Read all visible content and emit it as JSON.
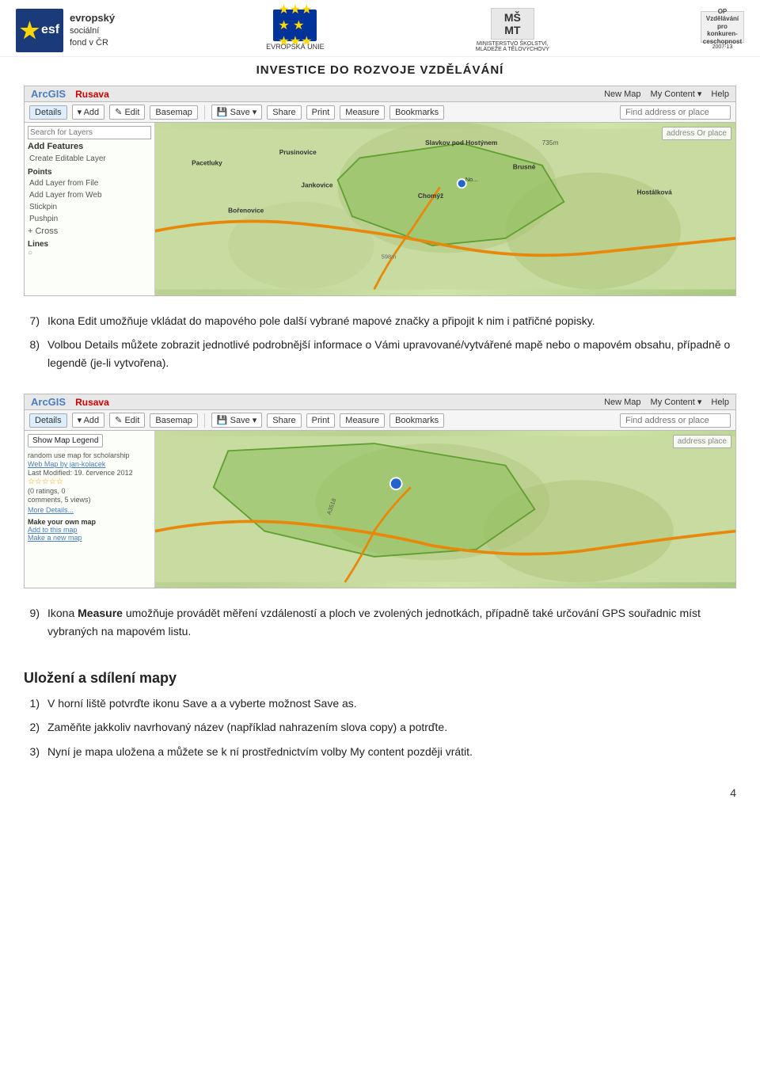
{
  "header": {
    "logo_esf_text": "esf",
    "logo_esf_subtitle1": "evropský",
    "logo_esf_subtitle2": "sociální",
    "logo_esf_subtitle3": "fond v ČR",
    "logo_eu_text": "EVROPSKÁ UNIE",
    "logo_msmt_subtitle": "MINISTERSTVO ŠKOLSTVÍ,\nMÁDEŽE A TĚLOVÝCHOVY",
    "logo_op_text": "OP Vzdělávání\npro\nkonkurenceschopnost",
    "investice_title": "INVESTICE DO ROZVOJE VZDĚLÁVÁNÍ"
  },
  "arcgis_bar1": {
    "brand": "ArcGIS",
    "map_name": "Rusava",
    "nav_items": [
      "New Map",
      "My Content ▾",
      "Help"
    ]
  },
  "arcgis_toolbar1": {
    "details_btn": "Details",
    "add_btn": "▾ Add",
    "edit_btn": "✎ Edit",
    "basemap_btn": "Basemap",
    "save_btn": "💾 Save ▾",
    "share_btn": "Share",
    "print_btn": "Print",
    "measure_btn": "Measure",
    "bookmarks_btn": "Bookmarks",
    "find_placeholder": "Find address or place"
  },
  "map1": {
    "left_panel": {
      "search_placeholder": "Search for Layers",
      "add_features_title": "Add Features",
      "points_label": "Points",
      "add_layer_title": "Add Layer from File",
      "add_layer_web": "Add Layer from Web",
      "stickpin_label": "Stickpin",
      "pushpin_label": "Pushpin",
      "cross_label": "Cross",
      "lines_label": "Lines",
      "create_layer": "Create Editable Layer"
    },
    "place_names": [
      "Pacetluky",
      "Prusinovice",
      "Slavkov pod Hostýnem",
      "735m",
      "Brusné",
      "Bořenovice",
      "Jankovice",
      "Chomýž",
      "Hostálková"
    ],
    "dot_label": "No...",
    "distance_label": "598m",
    "address_placeholder": "address Or place"
  },
  "paragraph7": {
    "num": "7)",
    "text": "Ikona Edit umožňuje vkládat do mapového pole další vybrané mapové značky a připojit k nim i patřičné popisky."
  },
  "paragraph8": {
    "num": "8)",
    "text": "Volbou Details můžete zobrazit jednotlivé podrobnější informace o Vámi upravované/vytvářené mapě nebo o mapovém obsahu, případně o legendě (je-li vytvořena)."
  },
  "arcgis_bar2": {
    "brand": "ArcGIS",
    "map_name": "Rusava",
    "nav_items": [
      "New Map",
      "My Content ▾",
      "Help"
    ]
  },
  "arcgis_toolbar2": {
    "details_btn": "Details",
    "add_btn": "▾ Add",
    "edit_btn": "✎ Edit",
    "basemap_btn": "Basemap",
    "save_btn": "💾 Save ▾",
    "share_btn": "Share",
    "print_btn": "Print",
    "measure_btn": "Measure",
    "bookmarks_btn": "Bookmarks",
    "find_placeholder": "Find address or place"
  },
  "map2": {
    "left_panel": {
      "show_legend_btn": "Show Map Legend",
      "random_use": "random use map for scholarship",
      "web_map_by": "Web Map by jan-kolacek",
      "last_modified": "Last Modified: 19. července 2012",
      "ratings": "(0 ratings, 0",
      "comments": "comments, 5 views)",
      "more_details": "More Details...",
      "make_map_title": "Make your own map",
      "add_to_map": "Add to this map",
      "make_new": "Make a new map"
    },
    "address_placeholder": "address place"
  },
  "paragraph9": {
    "num": "9)",
    "text_start": "Ikona",
    "measure_word": "Measure",
    "text_end": "umožňuje provádět měření vzdáleností a ploch ve zvolených jednotkách, případně také určování GPS souřadnic míst vybraných na mapovém listu."
  },
  "section_ulozeni": {
    "title": "Uložení a sdílení mapy",
    "items": [
      {
        "num": "1)",
        "text": "V horní liště potvrďte ikonu Save a a vyberte možnost Save as."
      },
      {
        "num": "2)",
        "text": "Zaměňte jakkoliv navrhovaný název (například nahrazením slova copy) a potrďte."
      },
      {
        "num": "3)",
        "text": "Nyní je mapa uložena a můžete se k ní prostřednictvím volby My content později vrátit."
      }
    ]
  },
  "page_number": "4"
}
